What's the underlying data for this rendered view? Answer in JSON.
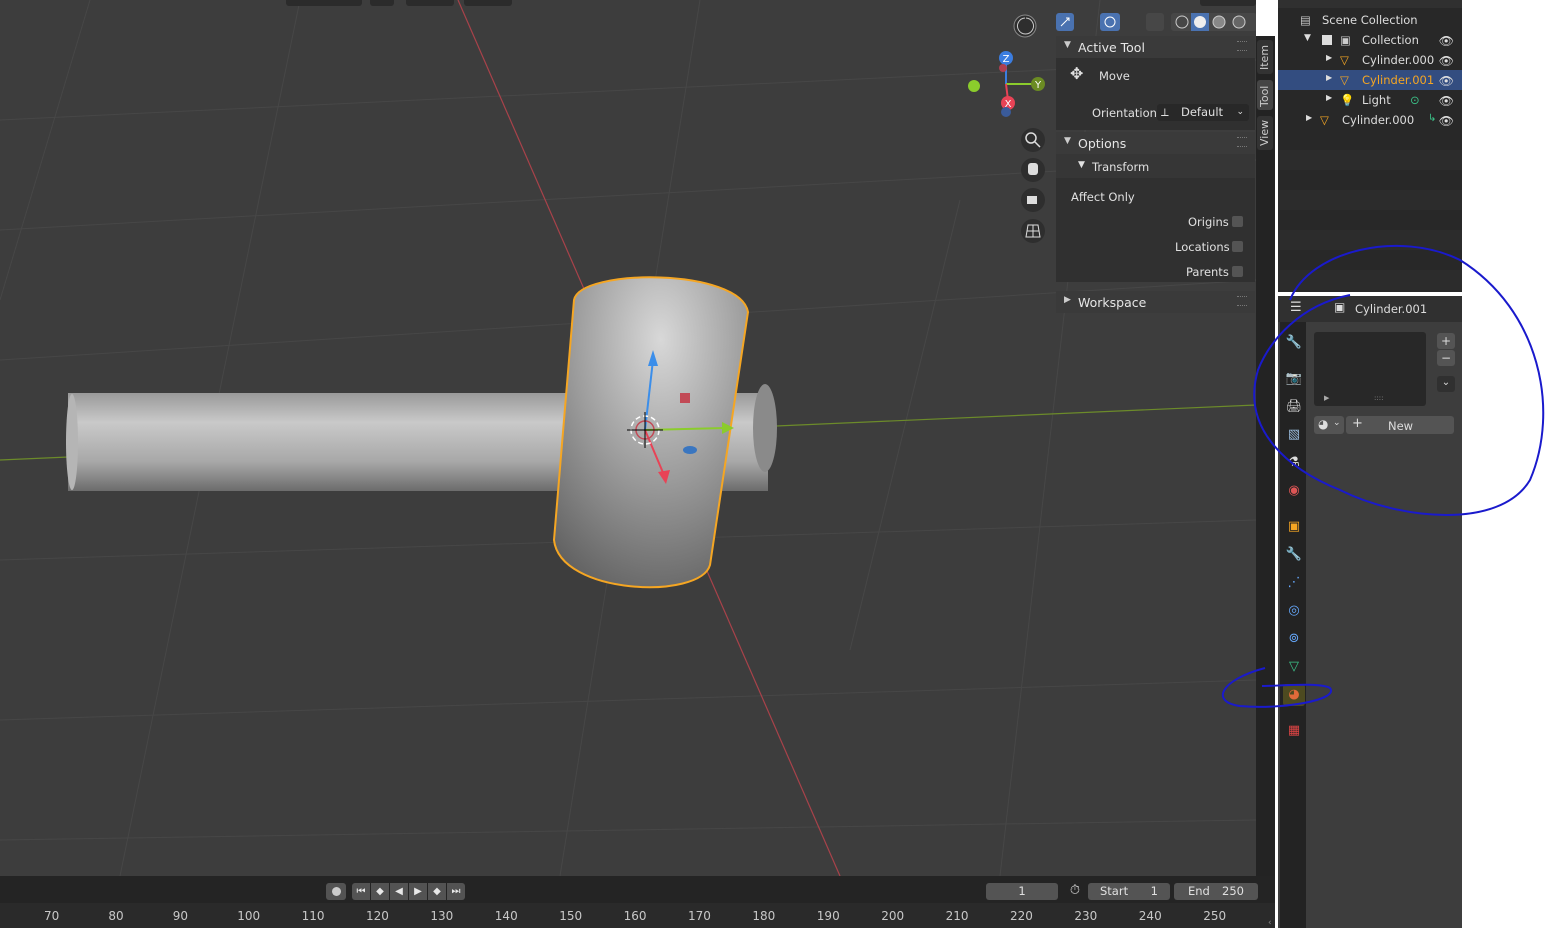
{
  "npanel": {
    "active_tool_header": "Active Tool",
    "tool_name": "Move",
    "orientation_label": "Orientation",
    "orientation_value": "Default",
    "options_header": "Options",
    "transform_header": "Transform",
    "affect_only_label": "Affect Only",
    "origins_label": "Origins",
    "locations_label": "Locations",
    "parents_label": "Parents",
    "workspace_header": "Workspace"
  },
  "sidetabs": {
    "item": "Item",
    "tool": "Tool",
    "view": "View"
  },
  "gizmo": {
    "z": "Z",
    "y": "Y",
    "x": "X"
  },
  "outliner": {
    "scene_collection": "Scene Collection",
    "rows": [
      {
        "label": "Collection"
      },
      {
        "label": "Cylinder.000"
      },
      {
        "label": "Cylinder.001"
      },
      {
        "label": "Light"
      },
      {
        "label": "Cylinder.000"
      }
    ]
  },
  "properties": {
    "object_name": "Cylinder.001",
    "new_button": "New",
    "add_slot": "+",
    "remove_slot": "−"
  },
  "timeline": {
    "current_frame": "1",
    "start_label": "Start",
    "start_value": "1",
    "end_label": "End",
    "end_value": "250",
    "ruler_ticks": [
      "70",
      "80",
      "90",
      "100",
      "110",
      "120",
      "130",
      "140",
      "150",
      "160",
      "170",
      "180",
      "190",
      "200",
      "210",
      "220",
      "230",
      "240",
      "250"
    ]
  },
  "colors": {
    "viewport_bg": "#3d3d3d",
    "selection_orange": "#f5a623",
    "active_row": "#334d80",
    "annotation_blue": "#1a1acc"
  }
}
